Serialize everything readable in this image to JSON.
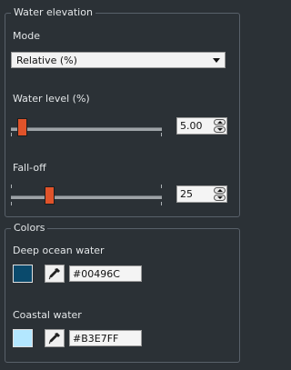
{
  "water_elevation": {
    "title": "Water elevation",
    "mode_label": "Mode",
    "mode_value": "Relative (%)",
    "water_level_label": "Water level (%)",
    "water_level_value": "5.00",
    "water_level_fraction": 0.075,
    "falloff_label": "Fall-off",
    "falloff_value": "25",
    "falloff_fraction": 0.25
  },
  "colors": {
    "title": "Colors",
    "deep_label": "Deep ocean water",
    "deep_hex": "#00496C",
    "deep_color": "#0a4a6c",
    "coastal_label": "Coastal water",
    "coastal_hex": "#B3E7FF",
    "coastal_color": "#b3e7ff"
  }
}
